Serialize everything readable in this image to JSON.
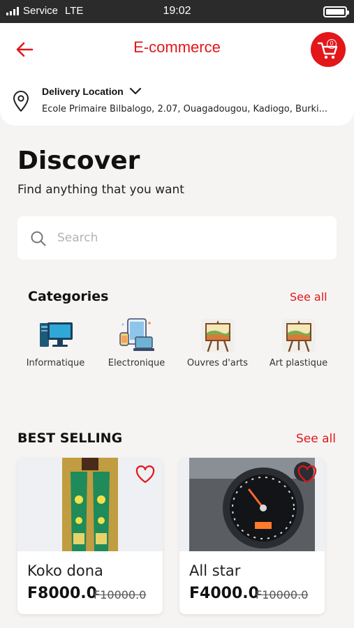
{
  "status_bar": {
    "carrier": "Service",
    "network": "LTE",
    "time": "19:02"
  },
  "header": {
    "title": "E-commerce",
    "cart_count": "0"
  },
  "delivery": {
    "label": "Delivery Location",
    "address": "École Primaire Bilbalogo, 2.07, Ouagadougou, Kadiogo, Burki..."
  },
  "discover": {
    "title": "Discover",
    "subtitle": "Find anything that you want"
  },
  "search": {
    "placeholder": "Search",
    "value": ""
  },
  "categories": {
    "title": "Categories",
    "see_all": "See all",
    "items": [
      {
        "label": "Informatique",
        "icon": "computer-icon"
      },
      {
        "label": "Electronique",
        "icon": "electronics-icon"
      },
      {
        "label": "Ouvres d'arts",
        "icon": "easel-painting-icon"
      },
      {
        "label": "Art plastique",
        "icon": "easel-painting-icon"
      }
    ]
  },
  "best_selling": {
    "title": "BEST SELLING",
    "see_all": "See all",
    "products": [
      {
        "name": "Koko dona",
        "price": "F8000.0",
        "old_price": "F10000.0"
      },
      {
        "name": "All star",
        "price": "F4000.0",
        "old_price": "F10000.0"
      }
    ]
  },
  "colors": {
    "accent": "#e3161a",
    "background": "#f5f4f2"
  }
}
